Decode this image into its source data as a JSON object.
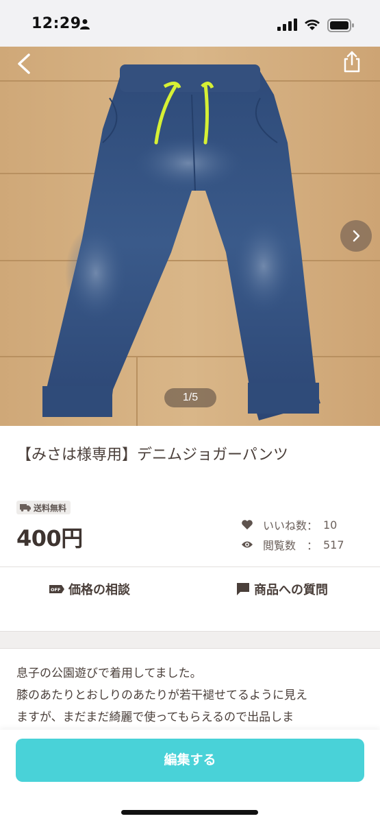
{
  "status_bar": {
    "time": "12:29"
  },
  "gallery": {
    "page_indicator": "1/5"
  },
  "item": {
    "title": "【みさは様専用】デニムジョガーパンツ",
    "shipping_badge": "送料無料",
    "price": "400円",
    "likes_label": "いいね数：",
    "likes_value": "10",
    "views_label": "閲覧数　：",
    "views_value": "517"
  },
  "actions": {
    "negotiate_label": "価格の相談",
    "question_label": "商品への質問"
  },
  "description": {
    "lines": [
      "息子の公園遊びで着用してました。",
      "膝のあたりとおしりのあたりが若干褪せてるように見え",
      "ますが、まだまだ綺麗で使ってもらえるので出品しま"
    ]
  },
  "bottom": {
    "edit_button_label": "編集する"
  },
  "colors": {
    "accent": "#49d2d8",
    "text": "#4a3f3a",
    "badge_bg": "#eeecea"
  },
  "icons": [
    "person-icon",
    "signal-icon",
    "wifi-icon",
    "battery-icon",
    "back-chevron-icon",
    "share-icon",
    "next-chevron-icon",
    "truck-icon",
    "heart-icon",
    "eye-icon",
    "price-tag-icon",
    "chat-bubble-icon"
  ]
}
